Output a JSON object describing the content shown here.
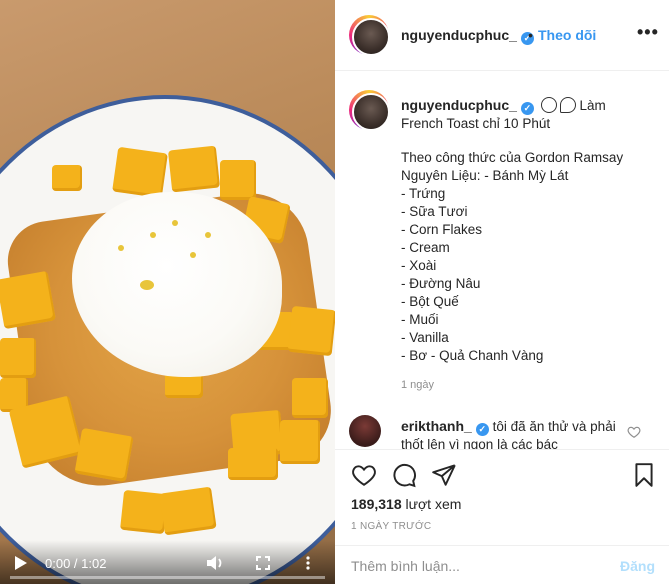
{
  "post": {
    "username": "nguyenducphuc_",
    "follow_sep": "•",
    "follow_label": "Theo dõi",
    "more_label": "•••"
  },
  "video": {
    "time": "0:00 / 1:02",
    "play_icon": "play-icon",
    "volume_icon": "volume-icon",
    "fullscreen_icon": "fullscreen-icon",
    "more_icon": "more-vertical-icon"
  },
  "caption": {
    "username": "nguyenducphuc_",
    "emoji": "face-emoji, magnifier-emoji",
    "title_line_1": "Làm",
    "title_line_2": "French Toast chỉ 10 Phút",
    "lines": [
      "Theo công thức của Gordon Ramsay",
      "Nguyên Liệu: - Bánh Mỳ Lát",
      "- Trứng",
      "- Sữa Tươi",
      "- Corn Flakes",
      "- Cream",
      "- Xoài",
      "- Đường Nâu",
      "- Bột Quế",
      "- Muối",
      "- Vanilla",
      "- Bơ - Quả Chanh Vàng"
    ],
    "age": "1 ngày"
  },
  "comment_2": {
    "username": "erikthanh_",
    "text": "tôi đã ăn thử và phải thốt lên vì ngon là các bác"
  },
  "actions": {
    "views_count": "189,318",
    "views_label": "lượt xem",
    "time_ago": "1 NGÀY TRƯỚC"
  },
  "add_comment": {
    "placeholder": "Thêm bình luận...",
    "post_label": "Đăng"
  },
  "colors": {
    "accent": "#3897f0",
    "plate_rim": "#3e5e9b",
    "mango": "#f4b21b"
  }
}
